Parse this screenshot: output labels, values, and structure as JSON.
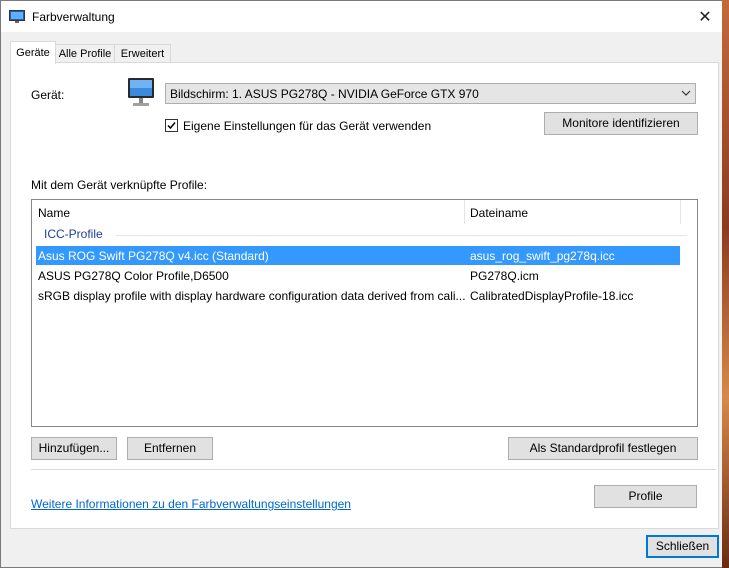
{
  "window": {
    "title": "Farbverwaltung",
    "close_glyph": "✕"
  },
  "tabs": [
    {
      "label": "Geräte",
      "active": true
    },
    {
      "label": "Alle Profile",
      "active": false
    },
    {
      "label": "Erweitert",
      "active": false
    }
  ],
  "device": {
    "label": "Gerät:",
    "selected": "Bildschirm: 1. ASUS PG278Q - NVIDIA GeForce GTX 970",
    "icon": "monitor-icon",
    "own_settings_label": "Eigene Einstellungen für das Gerät verwenden",
    "own_settings_checked": true,
    "identify_button": "Monitore identifizieren"
  },
  "profiles": {
    "section_label": "Mit dem Gerät verknüpfte Profile:",
    "columns": [
      "Name",
      "Dateiname"
    ],
    "group": "ICC-Profile",
    "rows": [
      {
        "name": "Asus ROG Swift PG278Q v4.icc (Standard)",
        "file": "asus_rog_swift_pg278q.icc",
        "selected": true
      },
      {
        "name": "ASUS PG278Q Color Profile,D6500",
        "file": "PG278Q.icm",
        "selected": false
      },
      {
        "name": "sRGB display profile with display hardware configuration data derived from cali...",
        "file": "CalibratedDisplayProfile-18.icc",
        "selected": false
      }
    ]
  },
  "buttons": {
    "add": "Hinzufügen...",
    "remove": "Entfernen",
    "set_default": "Als Standardprofil festlegen",
    "profile": "Profile",
    "close": "Schließen"
  },
  "info_link": "Weitere Informationen zu den Farbverwaltungseinstellungen",
  "colors": {
    "selection": "#3399ff",
    "link": "#0066cc",
    "group": "#1e3d9b",
    "default_border": "#0078d7"
  }
}
